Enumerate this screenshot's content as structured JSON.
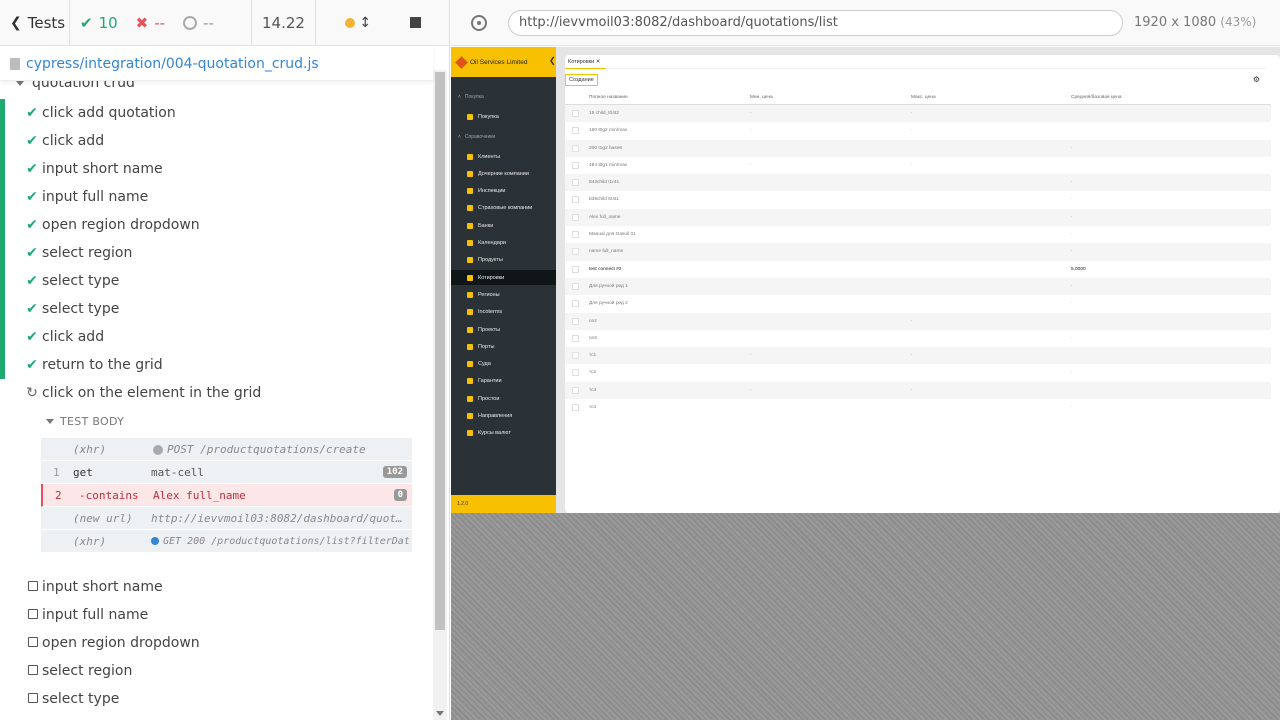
{
  "reporter": {
    "tests_label": "Tests",
    "passed": "10",
    "failed": "--",
    "pending": "--",
    "duration": "14.22",
    "spec_path": "cypress/integration/004-quotation_crud.js",
    "suite_title": "quotation crud",
    "tests": [
      {
        "label": "click add quotation",
        "state": "passed"
      },
      {
        "label": "click add",
        "state": "passed"
      },
      {
        "label": "input short name",
        "state": "passed"
      },
      {
        "label": "input full name",
        "state": "passed"
      },
      {
        "label": "open region dropdown",
        "state": "passed"
      },
      {
        "label": "select region",
        "state": "passed"
      },
      {
        "label": "select type",
        "state": "passed"
      },
      {
        "label": "select type",
        "state": "passed"
      },
      {
        "label": "click add",
        "state": "passed"
      },
      {
        "label": "return to the grid",
        "state": "passed"
      },
      {
        "label": "click on the element in the grid",
        "state": "running"
      }
    ],
    "test_body_label": "TEST BODY",
    "commands": [
      {
        "num": "",
        "name": "(xhr)",
        "msg": "POST /productquotations/create",
        "badge": ""
      },
      {
        "num": "1",
        "name": "get",
        "msg": "mat-cell",
        "badge": "102"
      },
      {
        "num": "2",
        "name": "-contains",
        "msg": "Alex full_name",
        "badge": "0"
      },
      {
        "num": "",
        "name": "(new url)",
        "msg": "http://ievvmoil03:8082/dashboard/quot…",
        "badge": ""
      },
      {
        "num": "",
        "name": "(xhr)",
        "msg": "GET 200 /productquotations/list?filterDat…",
        "badge": ""
      }
    ],
    "pending_tests": [
      "input short name",
      "input full name",
      "open region dropdown",
      "select region",
      "select type"
    ]
  },
  "runner": {
    "url": "http://ievvmoil03:8082/dashboard/quotations/list",
    "viewport": "1920 x 1080",
    "scale": "(43%)"
  },
  "app": {
    "brand": "Oil Services Limited",
    "version": "1.2.0",
    "sections": [
      "Покупка",
      "Справочники"
    ],
    "nav": [
      "Покупка",
      "Клиенты",
      "Дочерние компании",
      "Инспекции",
      "Страховые компании",
      "Банки",
      "Календари",
      "Продукты",
      "Котировки",
      "Регионы",
      "Incoterms",
      "Проекты",
      "Порты",
      "Суда",
      "Гарантии",
      "Простои",
      "Направления",
      "Курсы валют"
    ],
    "active_nav": "Котировки",
    "tab": "Котировки ✕",
    "create_label": "Создание",
    "columns": [
      "Полное название",
      "Мин. цена",
      "Макс. цена",
      "Средняя/базовая цена"
    ],
    "rows": [
      [
        "15 child_t04t2",
        "·",
        "·",
        ""
      ],
      [
        "160 t0g2 min/max",
        "·",
        "·",
        ""
      ],
      [
        "200 t1g2 base8",
        "",
        "",
        "·"
      ],
      [
        "484 t0g1 min/max",
        "·",
        "·",
        ""
      ],
      [
        "843child t1r41",
        "",
        "",
        "·"
      ],
      [
        "838child t04t1",
        "",
        "",
        "·"
      ],
      [
        "Alex full_name",
        "",
        "",
        "·"
      ],
      [
        "Manual для Gasoil 01",
        "",
        "",
        "·"
      ],
      [
        "name full_name",
        "",
        "",
        "·"
      ],
      [
        "test connect #2",
        "",
        "",
        "5,0000"
      ],
      [
        "Для ручной ред 1",
        "",
        "",
        "·"
      ],
      [
        "Для ручной ред 2",
        "",
        "",
        "·"
      ],
      [
        "ce2",
        "",
        "·",
        ""
      ],
      [
        "ce3",
        "",
        "",
        "·"
      ],
      [
        "тс1",
        "·",
        "·",
        ""
      ],
      [
        "тс2",
        "",
        "",
        "·"
      ],
      [
        "тс3",
        "·",
        "·",
        ""
      ],
      [
        "тс4",
        "",
        "",
        "·"
      ]
    ]
  }
}
